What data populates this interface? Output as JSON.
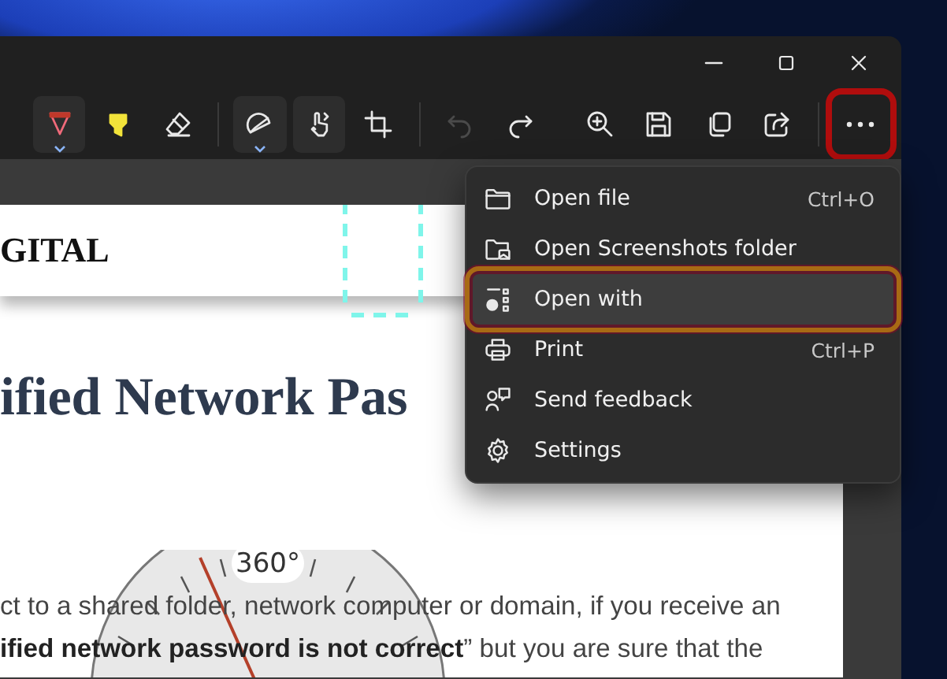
{
  "window": {
    "controls": [
      {
        "kind": "minimize"
      },
      {
        "kind": "maximize"
      },
      {
        "kind": "close"
      }
    ]
  },
  "toolbar": {
    "tools": [
      {
        "kind": "pen",
        "selected": true,
        "disabled": false,
        "dropdown": true,
        "highlighted": false
      },
      {
        "kind": "highlighter",
        "selected": false,
        "disabled": false,
        "highlighted": false
      },
      {
        "kind": "eraser",
        "selected": false,
        "disabled": false,
        "highlighted": false
      },
      {
        "kind": "divider"
      },
      {
        "kind": "ruler",
        "selected": true,
        "disabled": false,
        "dropdown": true,
        "highlighted": false
      },
      {
        "kind": "touch",
        "selected": true,
        "disabled": false,
        "highlighted": false
      },
      {
        "kind": "crop",
        "selected": false,
        "disabled": false,
        "highlighted": false
      },
      {
        "kind": "divider"
      },
      {
        "kind": "undo",
        "selected": false,
        "disabled": true,
        "highlighted": false
      },
      {
        "kind": "redo",
        "selected": false,
        "disabled": false,
        "highlighted": false
      },
      {
        "kind": "gap"
      },
      {
        "kind": "zoom",
        "selected": false,
        "disabled": false,
        "highlighted": false
      },
      {
        "kind": "save",
        "selected": false,
        "disabled": false,
        "highlighted": false
      },
      {
        "kind": "copy",
        "selected": false,
        "disabled": false,
        "highlighted": false
      },
      {
        "kind": "share",
        "selected": false,
        "disabled": false,
        "highlighted": false
      },
      {
        "kind": "divider"
      },
      {
        "kind": "more",
        "selected": false,
        "disabled": false,
        "highlighted": true
      }
    ]
  },
  "image": {
    "header_text": "GITAL",
    "heading": "ified Network Pas",
    "dial_label": "360°",
    "paragraph_lines": [
      "ct to a shared folder, network computer or domain, if you receive an",
      "**ified network password is not correct**” but you are sure that the"
    ]
  },
  "menu": {
    "items": [
      {
        "kind": "folder",
        "label": "Open file",
        "shortcut": "Ctrl+O",
        "selected": false,
        "highlighted": false
      },
      {
        "kind": "picture-folder",
        "label": "Open Screenshots folder",
        "selected": false,
        "highlighted": false
      },
      {
        "kind": "apps",
        "label": "Open with",
        "selected": true,
        "highlighted": true
      },
      {
        "kind": "print",
        "label": "Print",
        "shortcut": "Ctrl+P",
        "selected": false,
        "highlighted": false
      },
      {
        "kind": "feedback",
        "label": "Send feedback",
        "selected": false,
        "highlighted": false
      },
      {
        "kind": "settings",
        "label": "Settings",
        "selected": false,
        "highlighted": false
      }
    ]
  }
}
